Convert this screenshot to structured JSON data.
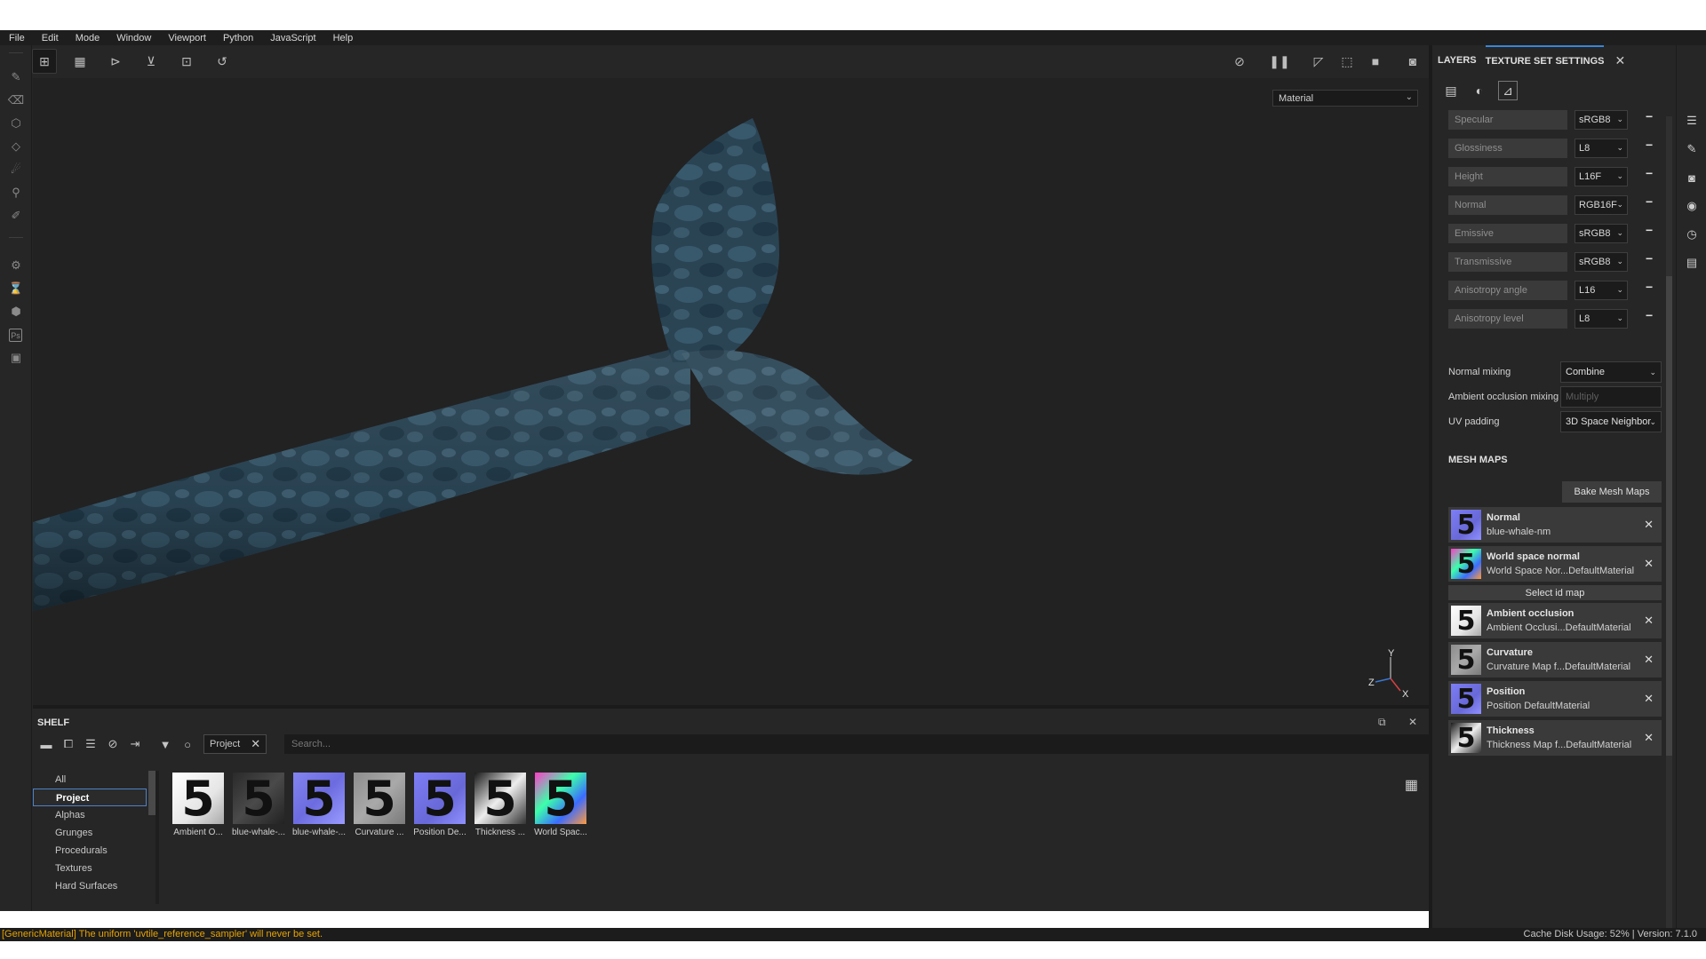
{
  "menu": [
    "File",
    "Edit",
    "Mode",
    "Window",
    "Viewport",
    "Python",
    "JavaScript",
    "Help"
  ],
  "viewport": {
    "material_select": "Material",
    "gizmo_axes": [
      "Y",
      "Z",
      "X"
    ]
  },
  "shelf": {
    "title": "SHELF",
    "filter_tag": "Project",
    "search_placeholder": "Search...",
    "categories": [
      "All",
      "Project",
      "Alphas",
      "Grunges",
      "Procedurals",
      "Textures",
      "Hard Surfaces"
    ],
    "selected_category": "Project",
    "resources": [
      {
        "label": "Ambient O...",
        "thumb": "c-ao"
      },
      {
        "label": "blue-whale-...",
        "thumb": "c-bw1"
      },
      {
        "label": "blue-whale-...",
        "thumb": "c-bw2"
      },
      {
        "label": "Curvature ...",
        "thumb": "c-curv"
      },
      {
        "label": "Position De...",
        "thumb": "c-pos"
      },
      {
        "label": "Thickness ...",
        "thumb": "c-thick"
      },
      {
        "label": "World Spac...",
        "thumb": "c-ws"
      }
    ],
    "thumb_glyph": "5"
  },
  "right_panel": {
    "tabs": [
      "LAYERS",
      "TEXTURE SET SETTINGS"
    ],
    "active_tab": "TEXTURE SET SETTINGS",
    "channels": [
      {
        "name": "Specular",
        "format": "sRGB8"
      },
      {
        "name": "Glossiness",
        "format": "L8"
      },
      {
        "name": "Height",
        "format": "L16F"
      },
      {
        "name": "Normal",
        "format": "RGB16F"
      },
      {
        "name": "Emissive",
        "format": "sRGB8"
      },
      {
        "name": "Transmissive",
        "format": "sRGB8"
      },
      {
        "name": "Anisotropy angle",
        "format": "L16"
      },
      {
        "name": "Anisotropy level",
        "format": "L8"
      }
    ],
    "normal_mixing": {
      "label": "Normal mixing",
      "value": "Combine"
    },
    "ao_mixing": {
      "label": "Ambient occlusion mixing",
      "value": "Multiply"
    },
    "uv_padding": {
      "label": "UV padding",
      "value": "3D Space Neighbor"
    },
    "mesh_maps_title": "MESH MAPS",
    "bake_button": "Bake Mesh Maps",
    "select_id_map": "Select id map",
    "mesh_maps": [
      {
        "title": "Normal",
        "file": "blue-whale-nm",
        "thumb": "c-pos"
      },
      {
        "title": "World space normal",
        "file": "World Space Nor...DefaultMaterial",
        "thumb": "c-ws"
      },
      {
        "title": "Ambient occlusion",
        "file": "Ambient Occlusi...DefaultMaterial",
        "thumb": "c-ao"
      },
      {
        "title": "Curvature",
        "file": "Curvature Map f...DefaultMaterial",
        "thumb": "c-curv"
      },
      {
        "title": "Position",
        "file": "Position DefaultMaterial",
        "thumb": "c-pos"
      },
      {
        "title": "Thickness",
        "file": "Thickness Map f...DefaultMaterial",
        "thumb": "c-thick"
      }
    ]
  },
  "status": {
    "message": "[GenericMaterial] The uniform 'uvtile_reference_sampler' will never be set.",
    "cache": "Cache Disk Usage:     52% | Version: 7.1.0",
    "message_color": "#e7a300"
  }
}
